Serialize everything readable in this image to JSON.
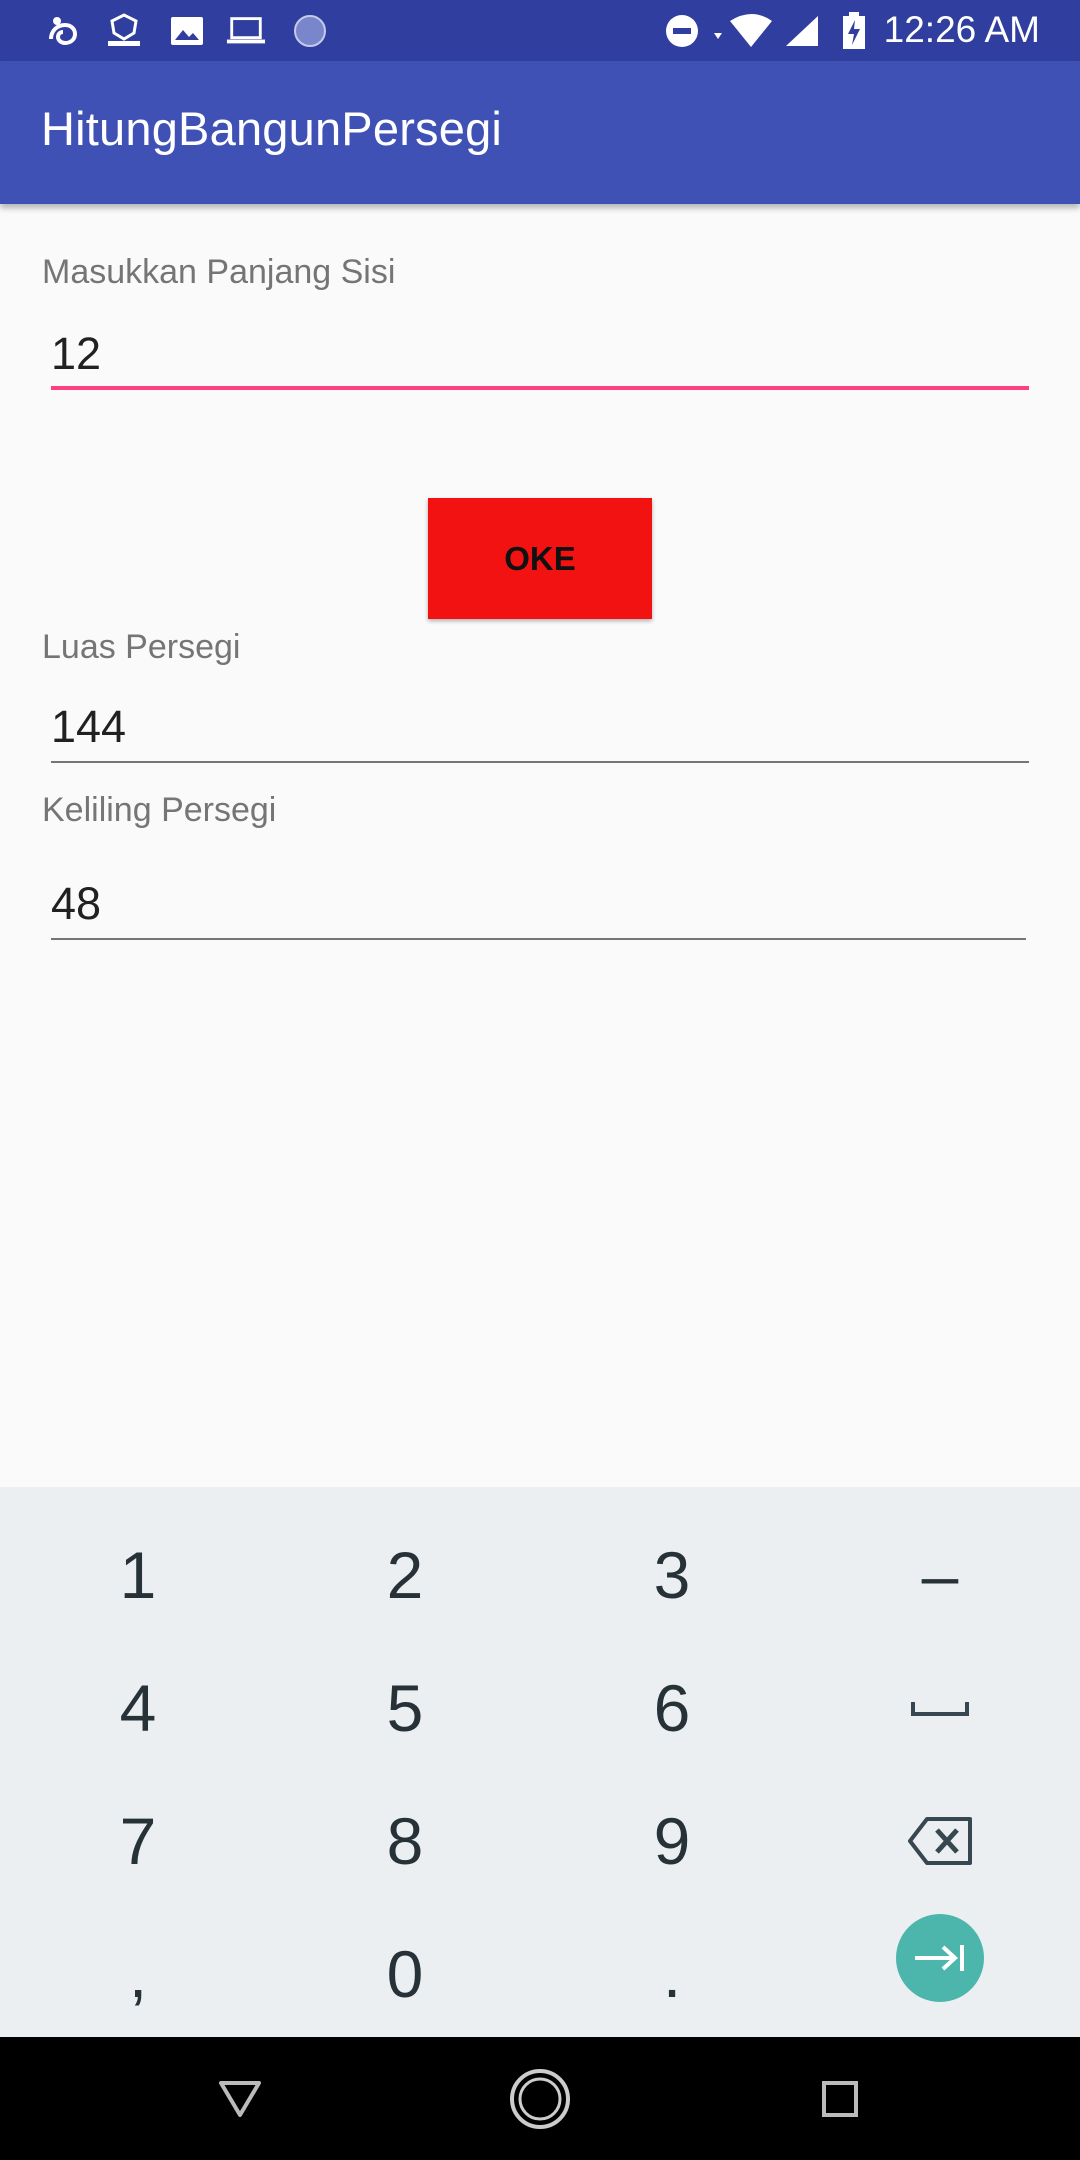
{
  "status_bar": {
    "time": "12:26 AM",
    "left_icons": [
      "uc-browser-icon",
      "app-badge-icon",
      "image-icon",
      "laptop-icon",
      "sync-icon"
    ],
    "right_icons": [
      "dnd-icon",
      "wifi-icon",
      "signal-icon",
      "battery-charging-icon"
    ]
  },
  "app_bar": {
    "title": "HitungBangunPersegi"
  },
  "form": {
    "side_label": "Masukkan Panjang Sisi",
    "side_value": "12",
    "button_label": "OKE",
    "area_label": "Luas Persegi",
    "area_value": "144",
    "perimeter_label": "Keliling Persegi",
    "perimeter_value": "48"
  },
  "keyboard": {
    "row1": [
      "1",
      "2",
      "3",
      "–"
    ],
    "row2": [
      "4",
      "5",
      "6",
      "space"
    ],
    "row3": [
      "7",
      "8",
      "9",
      "backspace"
    ],
    "row4": [
      ",",
      "0",
      ".",
      "next"
    ]
  },
  "colors": {
    "status_bar": "#303f9f",
    "app_bar": "#3f51b5",
    "accent": "#ff4081",
    "button": "#f21212",
    "enter_key": "#4db6ac"
  }
}
